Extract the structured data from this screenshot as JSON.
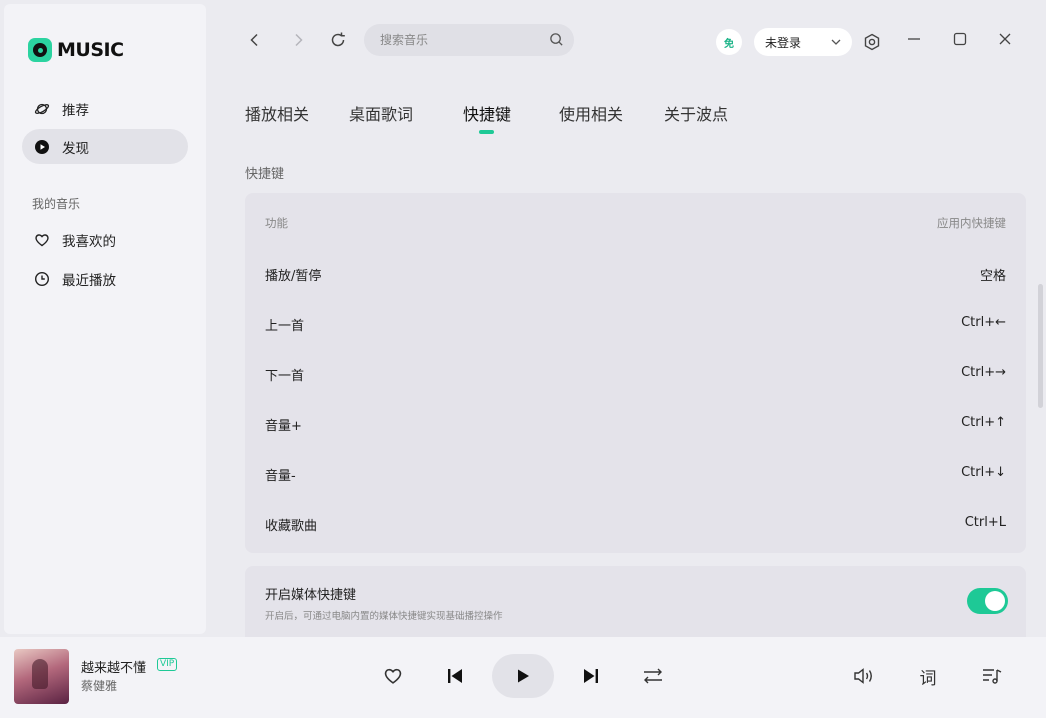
{
  "app": {
    "logo_text": "MUSIC",
    "accent": "#1ec996"
  },
  "sidebar": {
    "items": [
      {
        "label": "推荐",
        "icon": "planet-icon"
      },
      {
        "label": "发现",
        "icon": "play-circle-icon",
        "active": true
      }
    ],
    "my_music_label": "我的音乐",
    "my_items": [
      {
        "label": "我喜欢的",
        "icon": "heart-icon"
      },
      {
        "label": "最近播放",
        "icon": "clock-icon"
      }
    ]
  },
  "topbar": {
    "search_placeholder": "搜索音乐",
    "free_badge": "免",
    "login_label": "未登录"
  },
  "tabs": [
    {
      "label": "播放相关"
    },
    {
      "label": "桌面歌词"
    },
    {
      "label": "快捷键",
      "active": true
    },
    {
      "label": "使用相关"
    },
    {
      "label": "关于波点"
    }
  ],
  "shortcuts": {
    "heading": "快捷键",
    "col_function": "功能",
    "col_shortcut": "应用内快捷键",
    "rows": [
      {
        "function": "播放/暂停",
        "key": "空格"
      },
      {
        "function": "上一首",
        "key": "Ctrl+←"
      },
      {
        "function": "下一首",
        "key": "Ctrl+→"
      },
      {
        "function": "音量+",
        "key": "Ctrl+↑"
      },
      {
        "function": "音量-",
        "key": "Ctrl+↓"
      },
      {
        "function": "收藏歌曲",
        "key": "Ctrl+L"
      }
    ]
  },
  "media_keys": {
    "title": "开启媒体快捷键",
    "description": "开启后，可通过电脑内置的媒体快捷键实现基础播控操作",
    "enabled": true
  },
  "player": {
    "song_title": "越来越不懂",
    "vip_badge": "VIP",
    "artist": "蔡健雅",
    "lyric_button": "词"
  }
}
